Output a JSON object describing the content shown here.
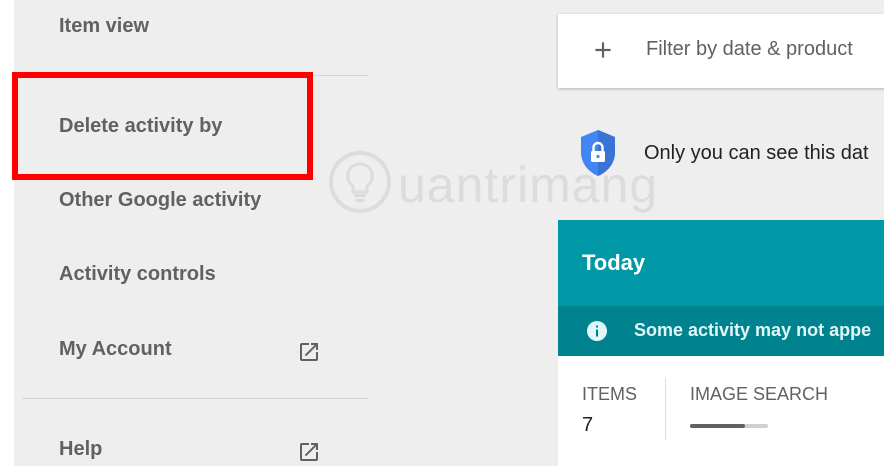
{
  "sidebar": {
    "items": [
      {
        "label": "Item view"
      },
      {
        "label": "Delete activity by"
      },
      {
        "label": "Other Google activity"
      },
      {
        "label": "Activity controls"
      },
      {
        "label": "My Account"
      },
      {
        "label": "Help"
      }
    ]
  },
  "main": {
    "filter": {
      "label": "Filter by date & product"
    },
    "privacy_notice": "Only you can see this dat",
    "today": {
      "title": "Today",
      "notice": "Some activity may not appe",
      "stats": [
        {
          "label": "ITEMS",
          "value": "7"
        },
        {
          "label": "IMAGE SEARCH",
          "bar_fraction": 0.71
        }
      ]
    }
  },
  "watermark": {
    "text": "uantrimang"
  },
  "colors": {
    "sidebar_bg": "#eeeeee",
    "highlight": "#ff0000",
    "teal": "#0097a7",
    "teal_dark": "#00838f",
    "shield": "#4285f4"
  }
}
